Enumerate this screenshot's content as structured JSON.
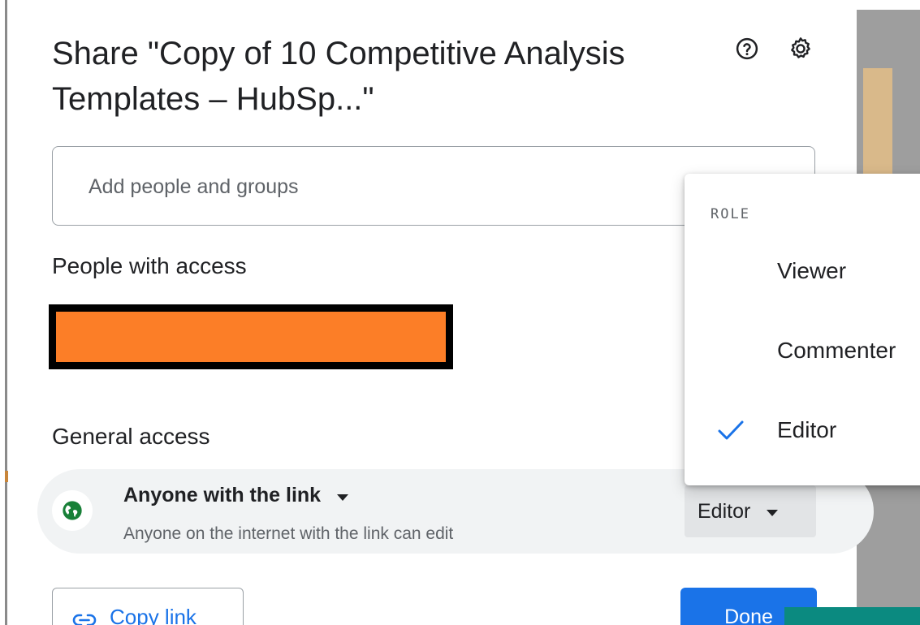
{
  "dialog": {
    "title": "Share \"Copy of 10 Competitive Analysis Templates – HubSp...\"",
    "help_icon": "help-circle-icon",
    "settings_icon": "gear-icon"
  },
  "add_people": {
    "placeholder": "Add people and groups"
  },
  "people_with_access": {
    "heading": "People with access"
  },
  "general_access": {
    "heading": "General access",
    "scope_label": "Anyone with the link",
    "description": "Anyone on the internet with the link can edit",
    "role_label": "Editor",
    "icon": "globe-icon",
    "icon_color": "#188038"
  },
  "role_menu": {
    "header": "ROLE",
    "items": [
      {
        "label": "Viewer",
        "selected": false
      },
      {
        "label": "Commenter",
        "selected": false
      },
      {
        "label": "Editor",
        "selected": true
      }
    ]
  },
  "footer": {
    "copy_link_label": "Copy link",
    "done_label": "Done"
  },
  "colors": {
    "accent": "#1a73e8",
    "redaction_fill": "#fc7e27",
    "redaction_border": "#000000"
  }
}
